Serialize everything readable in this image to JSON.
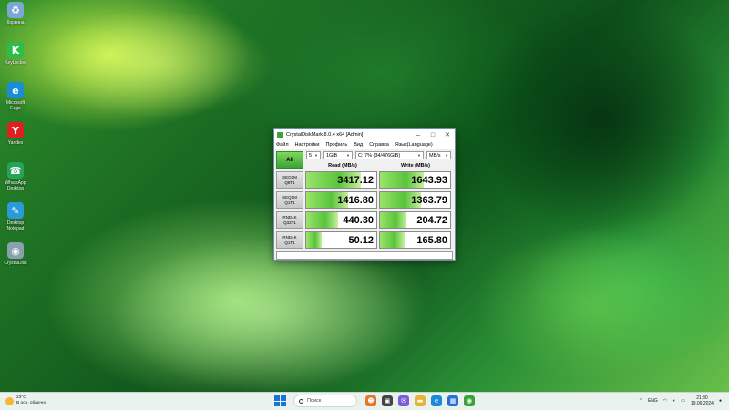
{
  "desktop": {
    "icons": [
      {
        "label": "Корзина",
        "glyph": "♻",
        "color": "#7aa7d6"
      },
      {
        "label": "KeyLocker",
        "glyph": "K",
        "color": "#2bbf48"
      },
      {
        "label": "Microsoft Edge",
        "glyph": "e",
        "color": "#1a8cd8"
      },
      {
        "label": "Yandex",
        "glyph": "Y",
        "color": "#e02020"
      },
      {
        "label": "WhatsApp Desktop",
        "glyph": "☎",
        "color": "#25a35a"
      },
      {
        "label": "Desktop Notepad",
        "glyph": "✎",
        "color": "#2a9bd8"
      },
      {
        "label": "CrystalDisk",
        "glyph": "◉",
        "color": "#8aa0b0"
      }
    ]
  },
  "window": {
    "title": "CrystalDiskMark 8.0.4 x64 [Admin]",
    "controls": [
      "–",
      "□",
      "✕"
    ],
    "menu": [
      "Файл",
      "Настройки",
      "Профиль",
      "Вид",
      "Справка",
      "Язык(Language)"
    ],
    "all_button": "All",
    "selects": {
      "count": "5",
      "size": "1GiB",
      "drive": "C: 7% (34/476GiB)",
      "unit": "MB/s"
    },
    "headers": {
      "read": "Read (MB/s)",
      "write": "Write (MB/s)"
    },
    "rows": [
      {
        "label1": "SEQ1M",
        "label2": "Q8T1",
        "read": "3417.12",
        "write": "1643.93",
        "read_frac": 0.78,
        "write_frac": 0.62
      },
      {
        "label1": "SEQ1M",
        "label2": "Q1T1",
        "read": "1416.80",
        "write": "1363.79",
        "read_frac": 0.6,
        "write_frac": 0.58
      },
      {
        "label1": "RND4K",
        "label2": "Q32T1",
        "read": "440.30",
        "write": "204.72",
        "read_frac": 0.45,
        "write_frac": 0.38
      },
      {
        "label1": "RND4K",
        "label2": "Q1T1",
        "read": "50.12",
        "write": "165.80",
        "read_frac": 0.22,
        "write_frac": 0.35
      }
    ]
  },
  "taskbar": {
    "weather_temp": "23°C",
    "weather_desc": "В осн. облачно",
    "search_placeholder": "Поиск",
    "apps": [
      {
        "name": "cartoon-icon",
        "glyph": "☻",
        "color": "#e07a2a"
      },
      {
        "name": "camera-icon",
        "glyph": "▣",
        "color": "#444444"
      },
      {
        "name": "chat-icon",
        "glyph": "✉",
        "color": "#7a5fd8"
      },
      {
        "name": "folder-icon",
        "glyph": "▬",
        "color": "#e8b33a"
      },
      {
        "name": "edge-icon",
        "glyph": "e",
        "color": "#1a8cd8"
      },
      {
        "name": "store-icon",
        "glyph": "▦",
        "color": "#2a6fd8"
      },
      {
        "name": "crystaldiskmark-icon",
        "glyph": "◉",
        "color": "#3aa33a"
      }
    ],
    "language": "ENG",
    "time": "21:30",
    "date": "19.06.2024"
  }
}
